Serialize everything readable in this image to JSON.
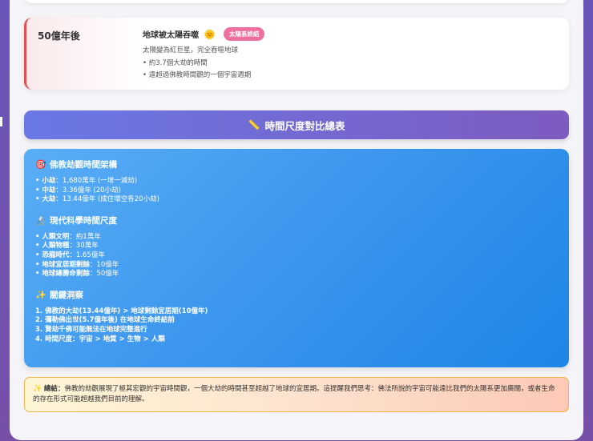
{
  "event": {
    "period": "50億年後",
    "title": "地球被太陽吞噬",
    "title_icon": "sun-emoji",
    "badge": "太陽系終結",
    "description": "太陽變為紅巨星，完全吞噬地球",
    "bullets": [
      "• 約3.7個大劫的時間",
      "• 遠超過佛教時間觀的一個宇宙週期"
    ]
  },
  "section_header": {
    "icon": "📏",
    "title": "時間尺度對比總表"
  },
  "comparison": {
    "buddhist": {
      "icon": "🎯",
      "heading": "佛教劫觀時間架構",
      "items": [
        {
          "k": "• 小劫",
          "v": "：1,680萬年 (一增一減劫)"
        },
        {
          "k": "• 中劫",
          "v": "：3.36億年 (20小劫)"
        },
        {
          "k": "• 大劫",
          "v": "：13.44億年 (成住壞空各20小劫)"
        }
      ]
    },
    "science": {
      "icon": "🔬",
      "heading": "現代科學時間尺度",
      "items": [
        {
          "k": "• 人類文明",
          "v": "：約1萬年"
        },
        {
          "k": "• 人類物種",
          "v": "：30萬年"
        },
        {
          "k": "• 恐龍時代",
          "v": "：1.65億年"
        },
        {
          "k": "• 地球宜居期剩餘",
          "v": "：10億年"
        },
        {
          "k": "• 地球總壽命剩餘",
          "v": "：50億年"
        }
      ]
    },
    "insights": {
      "icon": "✨",
      "heading": "關鍵洞察",
      "items": [
        "1. 佛教的大劫(13.44億年) > 地球剩餘宜居期(10億年)",
        "2. 彌勒佛出世(5.7億年後) 在地球生命終結前",
        "3. 賢劫千佛可能無法在地球完整進行",
        "4. 時間尺度：宇宙 > 地質 > 生物 > 人類"
      ]
    }
  },
  "summary": {
    "icon": "✨",
    "label": "總結：",
    "text": "佛教的劫觀展現了極其宏觀的宇宙時間觀，一個大劫的時間甚至超越了地球的宜居期。這提醒我們思考：佛法所說的宇宙可能遠比我們的太陽系更加廣闊，或者生命的存在形式可能超越我們目前的理解。"
  }
}
